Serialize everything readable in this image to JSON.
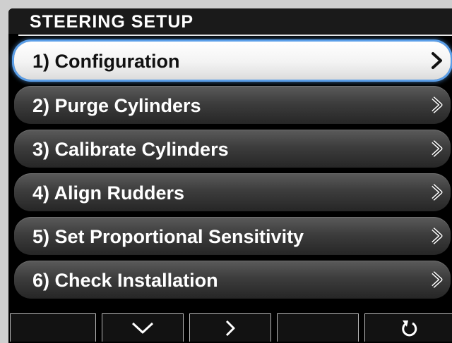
{
  "header": {
    "title": "STEERING SETUP"
  },
  "menu": {
    "selected_index": 0,
    "items": [
      {
        "label": "1) Configuration",
        "icon": "chevron-right-icon"
      },
      {
        "label": "2) Purge Cylinders",
        "icon": "chevron-right-icon"
      },
      {
        "label": "3) Calibrate Cylinders",
        "icon": "chevron-right-icon"
      },
      {
        "label": "4) Align Rudders",
        "icon": "chevron-right-icon"
      },
      {
        "label": "5) Set Proportional Sensitivity",
        "icon": "chevron-right-icon"
      },
      {
        "label": "6) Check Installation",
        "icon": "chevron-right-icon"
      }
    ]
  },
  "softkeys": [
    {
      "icon": "",
      "label": ""
    },
    {
      "icon": "chevron-down-icon",
      "label": ""
    },
    {
      "icon": "chevron-right-icon",
      "label": ""
    },
    {
      "icon": "",
      "label": ""
    },
    {
      "icon": "back-arrow-icon",
      "label": ""
    }
  ],
  "colors": {
    "selection_glow": "#5a9ee8",
    "item_gradient_top": "#5b5b5b",
    "item_gradient_bottom": "#262626",
    "selected_gradient_top": "#ffffff",
    "text_light": "#ffffff",
    "text_dark": "#111111"
  }
}
